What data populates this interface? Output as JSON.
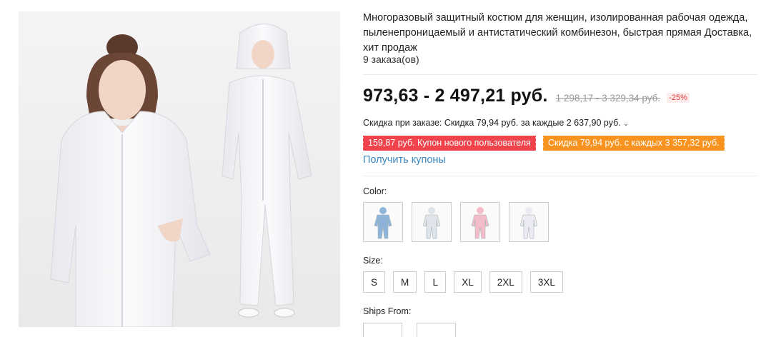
{
  "product": {
    "title": "Многоразовый защитный костюм для женщин, изолированная рабочая одежда, пыленепроницаемый и антистатический комбинезон, быстрая прямая Доставка, хит продаж",
    "orders": "9 заказа(ов)"
  },
  "pricing": {
    "price": "973,63 - 2 497,21 руб.",
    "old_price": "1 298,17 - 3 329,34 руб.",
    "discount": "-25%",
    "order_discount": "Скидка при заказе: Скидка 79,94 руб. за каждые 2 637,90 руб.",
    "chevron": "⌄"
  },
  "coupons": {
    "new_user": "159,87 руб. Купон нового пользователя",
    "store": "Скидка 79,94 руб. с каждых 3 357,32 руб.",
    "get_link": "Получить купоны"
  },
  "color": {
    "label": "Color:",
    "options": [
      {
        "icon": "suit-blue-thumbnail",
        "color": "#8fb4d9"
      },
      {
        "icon": "suit-white-thumbnail",
        "color": "#dfe4ea"
      },
      {
        "icon": "suit-pink-thumbnail",
        "color": "#f2bcc8"
      },
      {
        "icon": "suit-white-woman-thumbnail",
        "color": "#eceaf2"
      }
    ]
  },
  "size": {
    "label": "Size:",
    "options": [
      "S",
      "M",
      "L",
      "XL",
      "2XL",
      "3XL"
    ]
  },
  "ships_from": {
    "label": "Ships From:"
  },
  "colors": {
    "accent_link": "#3b88c3",
    "coupon_red": "#f0434b",
    "coupon_orange": "#f7931e",
    "discount_red": "#e8403f"
  }
}
